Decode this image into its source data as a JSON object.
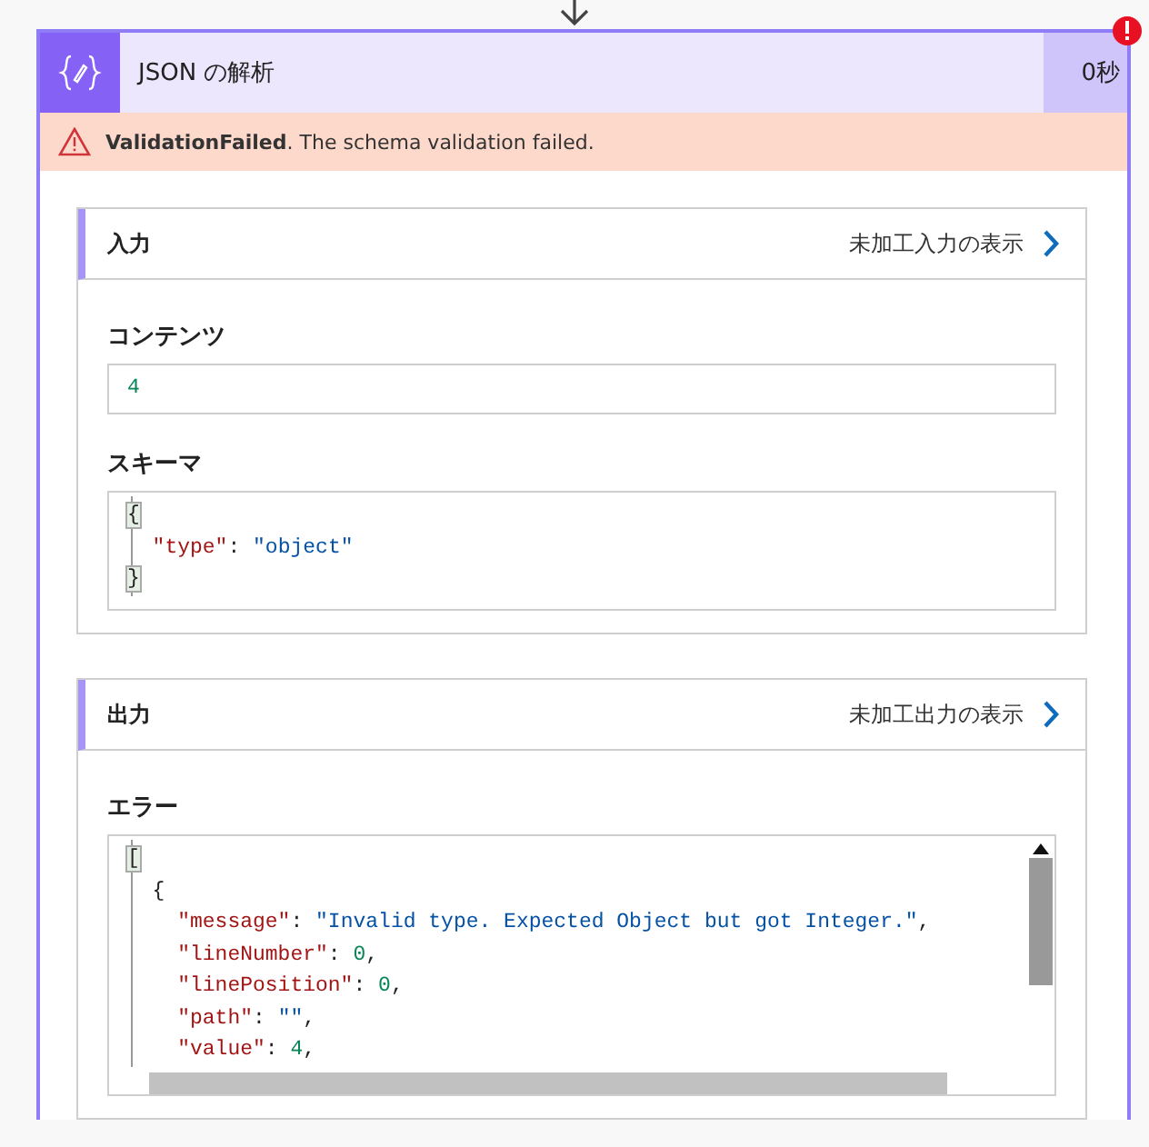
{
  "action": {
    "title": "JSON の解析",
    "duration": "0秒",
    "has_error": true
  },
  "banner": {
    "code": "ValidationFailed",
    "message": ". The schema validation failed."
  },
  "sections": [
    {
      "title": "入力",
      "link": "未加工入力の表示",
      "fields": [
        {
          "label": "コンテンツ",
          "kind": "value",
          "lines": [
            [
              {
                "kind": "number",
                "text": "4"
              }
            ]
          ]
        },
        {
          "label": "スキーマ",
          "kind": "code",
          "lines": [
            [
              {
                "kind": "bracket_match",
                "text": "{"
              }
            ],
            [
              {
                "kind": "key",
                "text": "\"type\""
              },
              {
                "kind": "punct",
                "text": ": "
              },
              {
                "kind": "string",
                "text": "\"object\""
              }
            ],
            [
              {
                "kind": "bracket_match",
                "text": "}"
              }
            ]
          ]
        }
      ]
    },
    {
      "title": "出力",
      "link": "未加工出力の表示",
      "fields": [
        {
          "label": "エラー",
          "kind": "scroll_code",
          "lines": [
            [
              {
                "kind": "bracket_match",
                "text": "["
              }
            ],
            [
              {
                "kind": "punct",
                "text": "{"
              }
            ],
            [
              {
                "kind": "key",
                "text": "\"message\""
              },
              {
                "kind": "punct",
                "text": ": "
              },
              {
                "kind": "string",
                "text": "\"Invalid type. Expected Object but got Integer.\""
              },
              {
                "kind": "punct",
                "text": ","
              }
            ],
            [
              {
                "kind": "key",
                "text": "\"lineNumber\""
              },
              {
                "kind": "punct",
                "text": ": "
              },
              {
                "kind": "number",
                "text": "0"
              },
              {
                "kind": "punct",
                "text": ","
              }
            ],
            [
              {
                "kind": "key",
                "text": "\"linePosition\""
              },
              {
                "kind": "punct",
                "text": ": "
              },
              {
                "kind": "number",
                "text": "0"
              },
              {
                "kind": "punct",
                "text": ","
              }
            ],
            [
              {
                "kind": "key",
                "text": "\"path\""
              },
              {
                "kind": "punct",
                "text": ": "
              },
              {
                "kind": "string",
                "text": "\"\""
              },
              {
                "kind": "punct",
                "text": ","
              }
            ],
            [
              {
                "kind": "key",
                "text": "\"value\""
              },
              {
                "kind": "punct",
                "text": ": "
              },
              {
                "kind": "number",
                "text": "4"
              },
              {
                "kind": "punct",
                "text": ","
              }
            ]
          ]
        }
      ]
    }
  ]
}
